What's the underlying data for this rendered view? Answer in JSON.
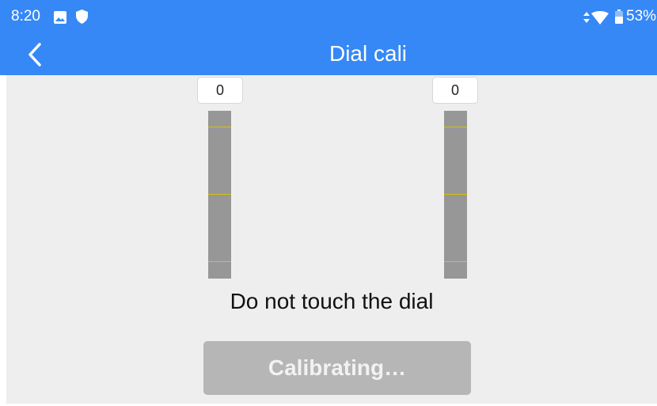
{
  "status_bar": {
    "time": "8:20",
    "battery_percent": "53%",
    "icons": [
      "image-icon",
      "shield-icon",
      "network-icon",
      "wifi-icon",
      "battery-icon"
    ]
  },
  "header": {
    "title": "Dial cali",
    "back_icon": "chevron-left-icon"
  },
  "dials": [
    {
      "value": "0"
    },
    {
      "value": "0"
    }
  ],
  "instruction": "Do not touch the dial",
  "button": {
    "label": "Calibrating…",
    "enabled": false
  },
  "colors": {
    "header": "#3588f6",
    "background": "#eeeeee",
    "bar": "#979797",
    "bar_mark": "#d6c400",
    "button_disabled": "#b6b6b6"
  }
}
